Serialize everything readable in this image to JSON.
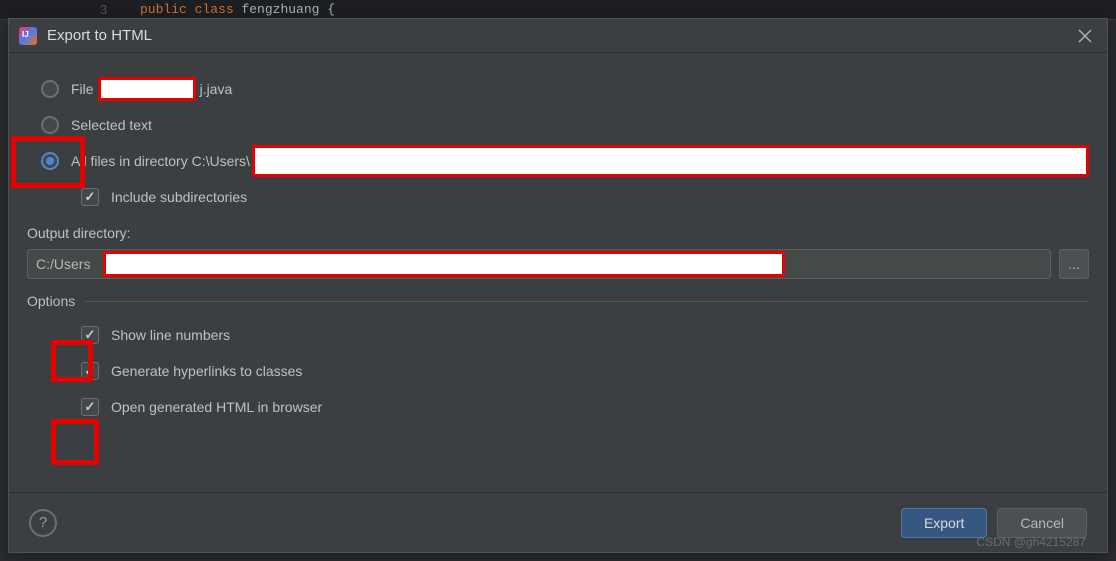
{
  "code_background": {
    "line_num": "3",
    "keyword_public": "public",
    "keyword_class": "class",
    "class_name": "fengzhuang",
    "brace": " {"
  },
  "dialog": {
    "title": "Export to HTML"
  },
  "radios": {
    "file_prefix": "File",
    "file_suffix": "j.java",
    "selected_text": "Selected text",
    "all_files_prefix": "All files in directory C:\\Users\\"
  },
  "checks": {
    "include_subdirs": "Include subdirectories",
    "show_line_numbers": "Show line numbers",
    "generate_hyperlinks": "Generate hyperlinks to classes",
    "open_browser": "Open generated HTML in browser"
  },
  "output": {
    "label": "Output directory:",
    "value_prefix": "C:/Users",
    "browse": "..."
  },
  "options": {
    "header": "Options"
  },
  "buttons": {
    "help": "?",
    "export": "Export",
    "cancel": "Cancel"
  },
  "watermark": "CSDN @gh4215287"
}
